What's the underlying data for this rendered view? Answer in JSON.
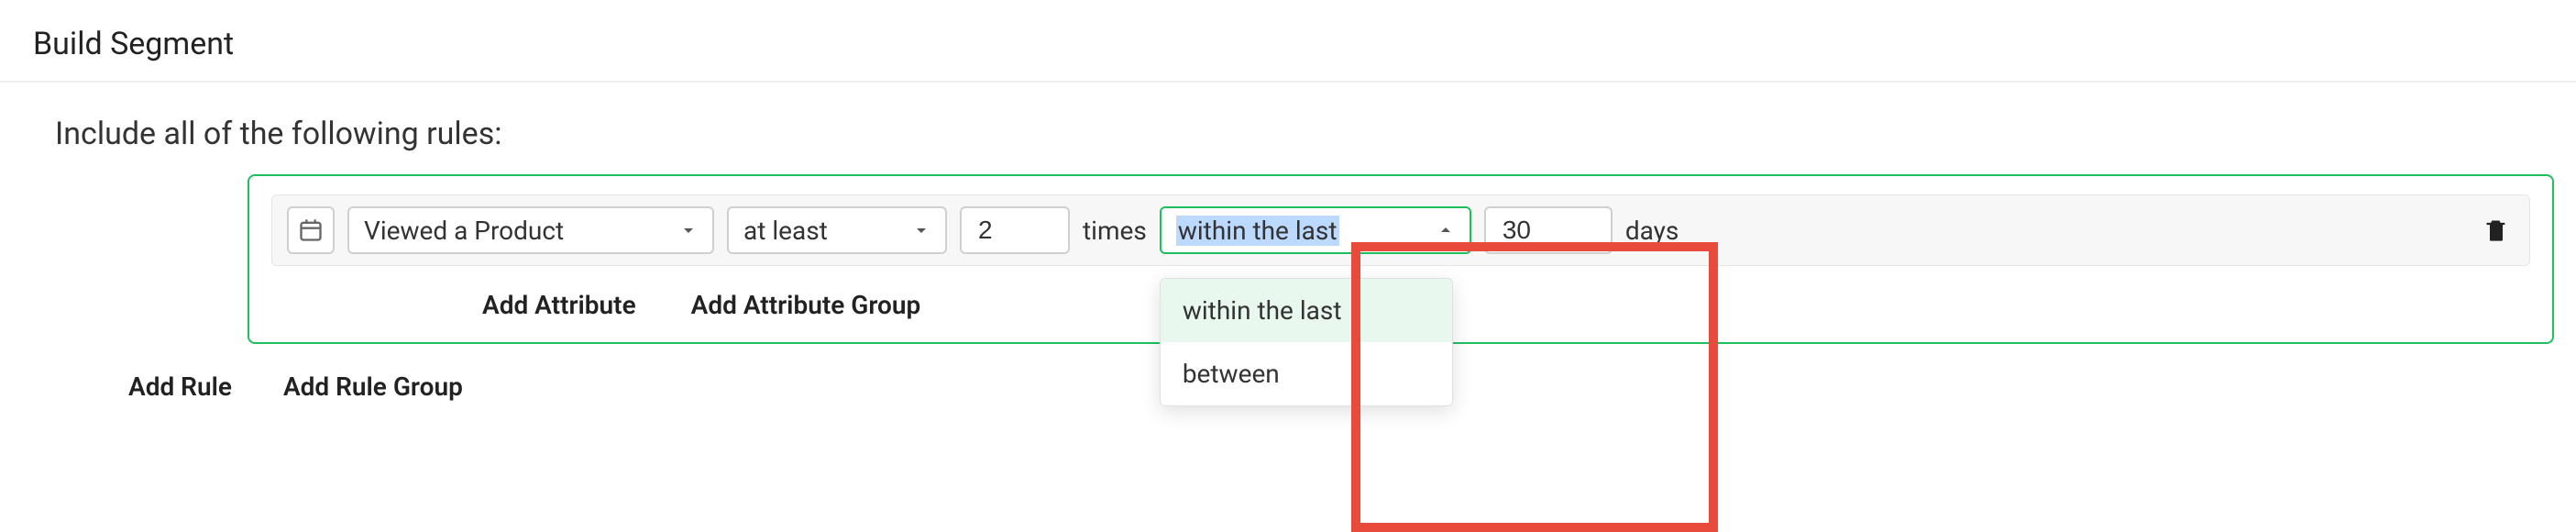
{
  "header": {
    "title": "Build Segment"
  },
  "rules": {
    "intro": "Include all of the following rules:",
    "rule1": {
      "event_select": "Viewed a Product",
      "operator_select": "at least",
      "count_value": "2",
      "times_label": "times",
      "range_select": "within the last",
      "range_options": {
        "opt1": "within the last",
        "opt2": "between"
      },
      "days_value": "30",
      "days_label": "days"
    },
    "add_attribute": "Add Attribute",
    "add_attribute_group": "Add Attribute Group"
  },
  "footer": {
    "add_rule": "Add Rule",
    "add_rule_group": "Add Rule Group"
  }
}
